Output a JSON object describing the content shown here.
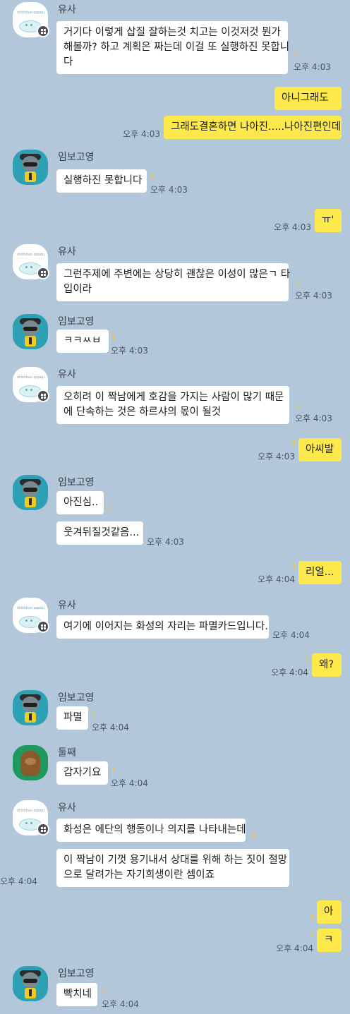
{
  "messages": [
    {
      "side": "in",
      "sender": "유사",
      "avatar": "yusa",
      "lines": [
        "거기다 이렇게 삽질 잘하는것 치고는 이것저것 뭔가",
        "해볼까? 하고 계획은 짜는데 이걸 또 실행하진 못합니",
        "다"
      ],
      "time": "오후 4:03",
      "unread": "1"
    },
    {
      "side": "out",
      "lines": [
        "아니그래도"
      ],
      "time": "",
      "unread": ""
    },
    {
      "side": "out",
      "lines": [
        "그래도결혼하면 나아진.....나아진편인데"
      ],
      "time": "오후 4:03",
      "unread": "1"
    },
    {
      "side": "in",
      "sender": "임보고영",
      "avatar": "im",
      "lines": [
        "실행하진 못합니다"
      ],
      "time": "오후 4:03",
      "unread": "1"
    },
    {
      "side": "out",
      "lines": [
        "ㅠ'"
      ],
      "time": "오후 4:03",
      "unread": "1"
    },
    {
      "side": "in",
      "sender": "유사",
      "avatar": "yusa",
      "lines": [
        "그런주제에 주변에는 상당히 괜찮은 이성이 많은ㄱ 타",
        "입이라"
      ],
      "time": "오후 4:03",
      "unread": "1"
    },
    {
      "side": "in",
      "sender": "임보고영",
      "avatar": "im",
      "lines": [
        "ㅋㅋㅆㅂ"
      ],
      "time": "오후 4:03",
      "unread": "1"
    },
    {
      "side": "in",
      "sender": "유사",
      "avatar": "yusa",
      "lines": [
        "오히려 이 짝남에게 호감을 가지는 사람이 많기 때문",
        "에 단속하는 것은 하르샤의 몫이 될것"
      ],
      "time": "오후 4:03",
      "unread": "1"
    },
    {
      "side": "out",
      "lines": [
        "아씨발"
      ],
      "time": "오후 4:03",
      "unread": "1"
    },
    {
      "side": "in",
      "sender": "임보고영",
      "avatar": "im",
      "lines": [
        "아진심.."
      ],
      "time": "",
      "unread": "1"
    },
    {
      "side": "in",
      "lines": [
        "웃겨뒤질것같음..."
      ],
      "time": "오후 4:03",
      "unread": "1"
    },
    {
      "side": "out",
      "lines": [
        "리얼..."
      ],
      "time": "오후 4:04",
      "unread": "1"
    },
    {
      "side": "in",
      "sender": "유사",
      "avatar": "yusa",
      "lines": [
        "여기에 이어지는 화성의 자리는 파멸카드입니다."
      ],
      "time": "오후 4:04",
      "unread": "1"
    },
    {
      "side": "out",
      "lines": [
        "왜?"
      ],
      "time": "오후 4:04",
      "unread": "1"
    },
    {
      "side": "in",
      "sender": "임보고영",
      "avatar": "im",
      "lines": [
        "파멸"
      ],
      "time": "오후 4:04",
      "unread": "1"
    },
    {
      "side": "in",
      "sender": "둘째",
      "avatar": "dul",
      "lines": [
        "갑자기요"
      ],
      "time": "오후 4:04",
      "unread": "1"
    },
    {
      "side": "in",
      "sender": "유사",
      "avatar": "yusa",
      "lines": [
        "화성은 에단의 행동이나 의지를 나타내는데"
      ],
      "time": "",
      "unread": "1"
    },
    {
      "side": "in",
      "lines": [
        "이 짝남이 기껏 용기내서 상대를 위해 하는 짓이 절망",
        "으로 달려가는 자기희생이란 셈이죠"
      ],
      "time": "오후 4:04",
      "unread": ""
    },
    {
      "side": "out",
      "lines": [
        "아"
      ],
      "time": "",
      "unread": "1"
    },
    {
      "side": "out",
      "lines": [
        "ㅋ"
      ],
      "time": "오후 4:04",
      "unread": "1"
    },
    {
      "side": "in",
      "sender": "임보고영",
      "avatar": "im",
      "lines": [
        "빡치네"
      ],
      "time": "오후 4:04",
      "unread": "1"
    }
  ],
  "avatar_caption": "ohbhbuo qqaqu",
  "colors": {
    "background": "#b2c7da",
    "incoming": "#ffffff",
    "outgoing": "#fde94b",
    "unread": "#e8c84b"
  }
}
